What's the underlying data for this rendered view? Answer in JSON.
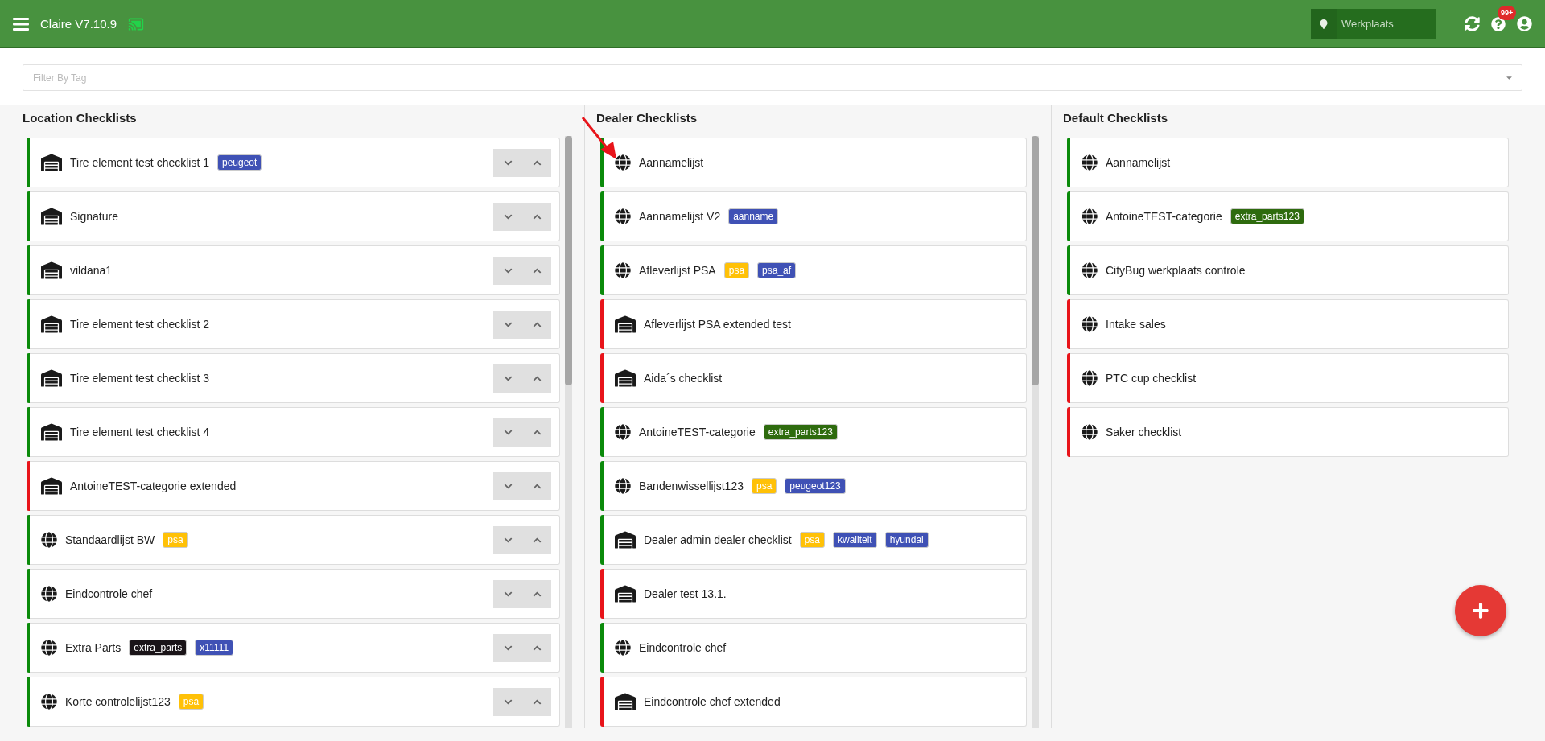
{
  "header": {
    "title": "Claire V7.10.9",
    "location": "Werkplaats",
    "notification_badge": "99+"
  },
  "filter": {
    "placeholder": "Filter By Tag"
  },
  "columns": [
    {
      "kind": "location",
      "title": "Location Checklists",
      "items": [
        {
          "kind": "garage",
          "name": "Tire element test checklist 1",
          "color": "#0a8a0a",
          "tags": [
            {
              "label": "peugeot",
              "color": "#3f51b5"
            }
          ]
        },
        {
          "kind": "garage",
          "name": "Signature",
          "color": "#0a8a0a"
        },
        {
          "kind": "garage",
          "name": "vildana1",
          "color": "#0a8a0a"
        },
        {
          "kind": "garage",
          "name": "Tire element test checklist 2",
          "color": "#0a8a0a"
        },
        {
          "kind": "garage",
          "name": "Tire element test checklist 3",
          "color": "#0a8a0a"
        },
        {
          "kind": "garage",
          "name": "Tire element test checklist 4",
          "color": "#0a8a0a"
        },
        {
          "kind": "garage",
          "name": "AntoineTEST-categorie extended",
          "color": "#e8141a"
        },
        {
          "kind": "globe",
          "name": "Standaardlijst BW",
          "color": "#0a8a0a",
          "tags": [
            {
              "label": "psa",
              "color": "#ffc107"
            }
          ]
        },
        {
          "kind": "globe",
          "name": "Eindcontrole chef",
          "color": "#0a8a0a"
        },
        {
          "kind": "globe",
          "name": "Extra Parts",
          "color": "#0a8a0a",
          "tags": [
            {
              "label": "extra_parts",
              "color": "#1a1418"
            },
            {
              "label": "x11111",
              "color": "#3f51b5"
            }
          ]
        },
        {
          "kind": "globe",
          "name": "Korte controlelijst123",
          "color": "#0a8a0a",
          "tags": [
            {
              "label": "psa",
              "color": "#ffc107"
            }
          ]
        }
      ]
    },
    {
      "kind": "dealer",
      "title": "Dealer Checklists",
      "items": [
        {
          "kind": "globe",
          "name": "Aannamelijst",
          "color": "#0a8a0a"
        },
        {
          "kind": "globe",
          "name": "Aannamelijst V2",
          "color": "#0a8a0a",
          "tags": [
            {
              "label": "aanname",
              "color": "#3f51b5"
            }
          ]
        },
        {
          "kind": "globe",
          "name": "Afleverlijst PSA",
          "color": "#0a8a0a",
          "tags": [
            {
              "label": "psa",
              "color": "#ffc107"
            },
            {
              "label": "psa_af",
              "color": "#3f51b5"
            }
          ]
        },
        {
          "kind": "garage",
          "name": "Afleverlijst PSA extended test",
          "color": "#e8141a"
        },
        {
          "kind": "garage",
          "name": "Aida´s checklist",
          "color": "#e8141a"
        },
        {
          "kind": "globe",
          "name": "AntoineTEST-categorie",
          "color": "#0a8a0a",
          "tags": [
            {
              "label": "extra_parts123",
              "color": "#2e6b0e"
            }
          ]
        },
        {
          "kind": "globe",
          "name": "Bandenwissellijst123",
          "color": "#0a8a0a",
          "tags": [
            {
              "label": "psa",
              "color": "#ffc107"
            },
            {
              "label": "peugeot123",
              "color": "#3f51b5"
            }
          ]
        },
        {
          "kind": "garage",
          "name": "Dealer admin dealer checklist",
          "color": "#0a8a0a",
          "tags": [
            {
              "label": "psa",
              "color": "#ffc107"
            },
            {
              "label": "kwaliteit",
              "color": "#3f51b5"
            },
            {
              "label": "hyundai",
              "color": "#3f51b5"
            }
          ]
        },
        {
          "kind": "garage",
          "name": "Dealer test 13.1.",
          "color": "#e8141a"
        },
        {
          "kind": "globe",
          "name": "Eindcontrole chef",
          "color": "#0a8a0a"
        },
        {
          "kind": "garage",
          "name": "Eindcontrole chef extended",
          "color": "#e8141a"
        }
      ]
    },
    {
      "kind": "default",
      "title": "Default Checklists",
      "items": [
        {
          "kind": "globe",
          "name": "Aannamelijst",
          "color": "#0a8a0a"
        },
        {
          "kind": "globe",
          "name": "AntoineTEST-categorie",
          "color": "#0a8a0a",
          "tags": [
            {
              "label": "extra_parts123",
              "color": "#2e6b0e"
            }
          ]
        },
        {
          "kind": "globe",
          "name": "CityBug werkplaats controle",
          "color": "#0a8a0a"
        },
        {
          "kind": "globe",
          "name": "Intake sales",
          "color": "#e8141a"
        },
        {
          "kind": "globe",
          "name": "PTC cup checklist",
          "color": "#e8141a"
        },
        {
          "kind": "globe",
          "name": "Saker checklist",
          "color": "#e8141a"
        }
      ]
    }
  ]
}
